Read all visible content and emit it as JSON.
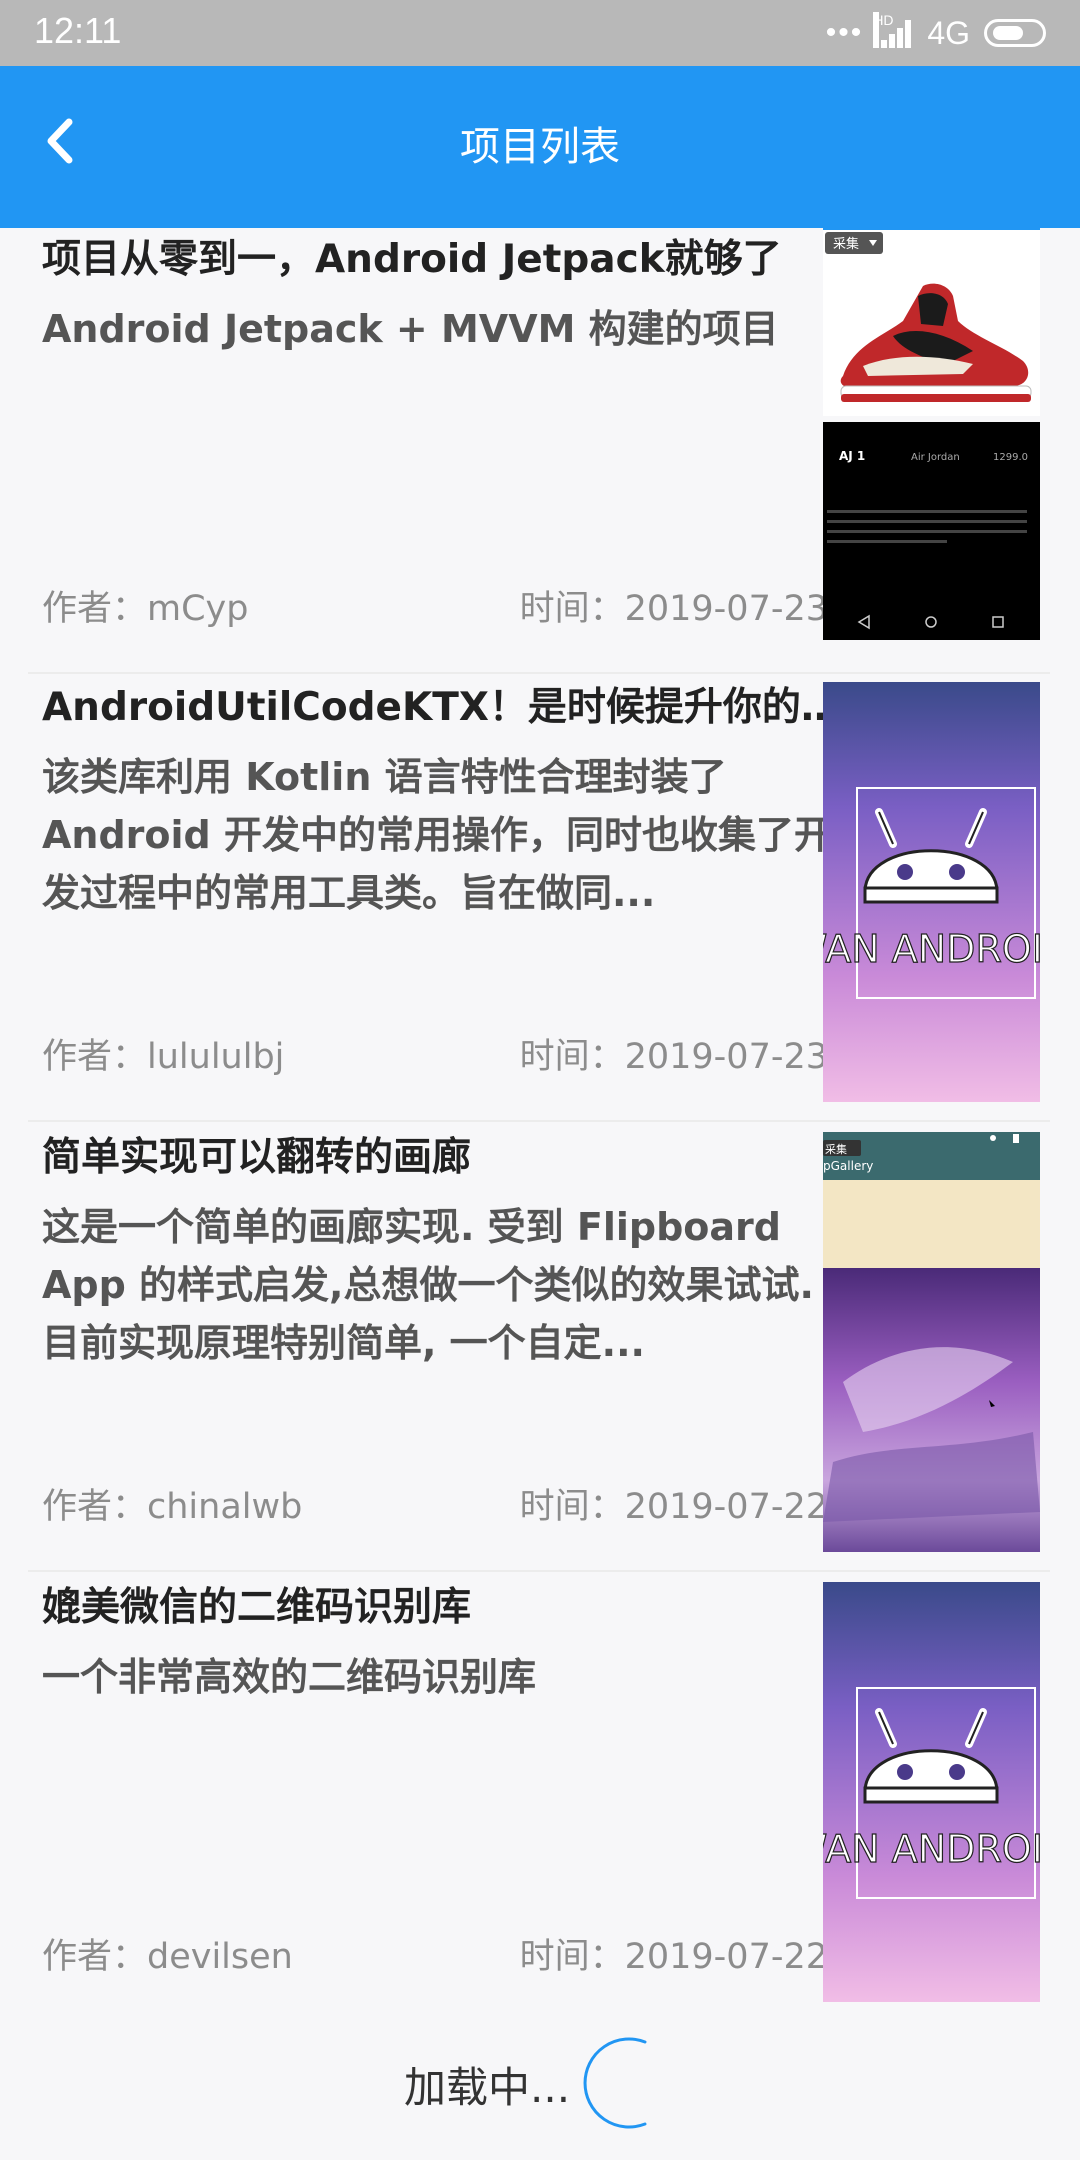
{
  "status_bar": {
    "time": "12:11",
    "network": "4G",
    "signal_label": "HD"
  },
  "app_bar": {
    "title": "项目列表"
  },
  "items": [
    {
      "title": "项目从零到一，Android Jetpack就够了",
      "desc": "Android Jetpack + MVVM 构建的项目",
      "author": "作者：mCyp",
      "time": "时间：2019-07-23",
      "thumb": {
        "top_label": "采集",
        "product": "AJ 1",
        "brand": "Air Jordan",
        "price": "1299.0"
      }
    },
    {
      "title": "AndroidUtilCodeKTX！是时候提升你的开发效率了！（持续更新中...）",
      "desc": "该类库利用 Kotlin 语言特性合理封装了 Android 开发中的常用操作，同时也收集了开发过程中的常用工具类。旨在做同...",
      "author": "作者：lulululbj",
      "time": "时间：2019-07-23",
      "thumb": {
        "label": "WAN ANDROID"
      }
    },
    {
      "title": "简单实现可以翻转的画廊",
      "desc": "这是一个简单的画廊实现. 受到 Flipboard App 的样式启发,总想做一个类似的效果试试. 目前实现原理特别简单, 一个自定...",
      "author": "作者：chinalwb",
      "time": "时间：2019-07-22",
      "thumb": {
        "top_label": "采集",
        "app": "pGallery"
      }
    },
    {
      "title": "媲美微信的二维码识别库",
      "desc": "一个非常高效的二维码识别库",
      "author": "作者：devilsen",
      "time": "时间：2019-07-22",
      "thumb": {
        "label": "WAN ANDROID"
      }
    }
  ],
  "footer": {
    "loading_text": "加载中..."
  }
}
